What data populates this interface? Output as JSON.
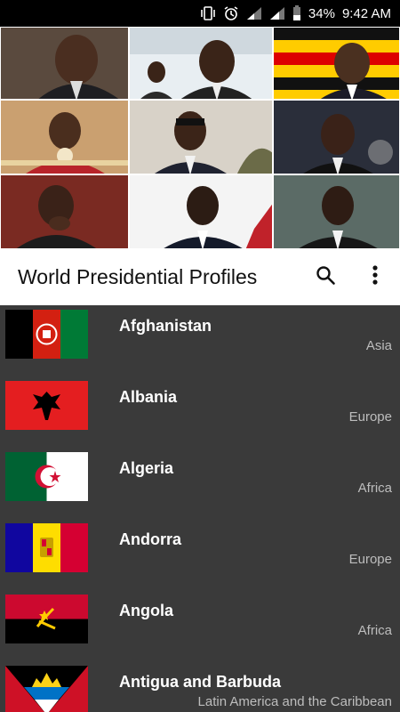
{
  "status_bar": {
    "battery": "34%",
    "time": "9:42 AM"
  },
  "app_bar": {
    "title": "World Presidential Profiles",
    "search_icon": "search-icon",
    "menu_icon": "more-vert-icon"
  },
  "colors": {
    "list_background": "#3a3a3a",
    "app_bar": "#ffffff",
    "region_text": "#bdbdbd"
  },
  "countries": [
    {
      "name": "Afghanistan",
      "region": "Asia"
    },
    {
      "name": "Albania",
      "region": "Europe"
    },
    {
      "name": "Algeria",
      "region": "Africa"
    },
    {
      "name": "Andorra",
      "region": "Europe"
    },
    {
      "name": "Angola",
      "region": "Africa"
    },
    {
      "name": "Antigua and Barbuda",
      "region": "Latin America and the Caribbean"
    }
  ]
}
